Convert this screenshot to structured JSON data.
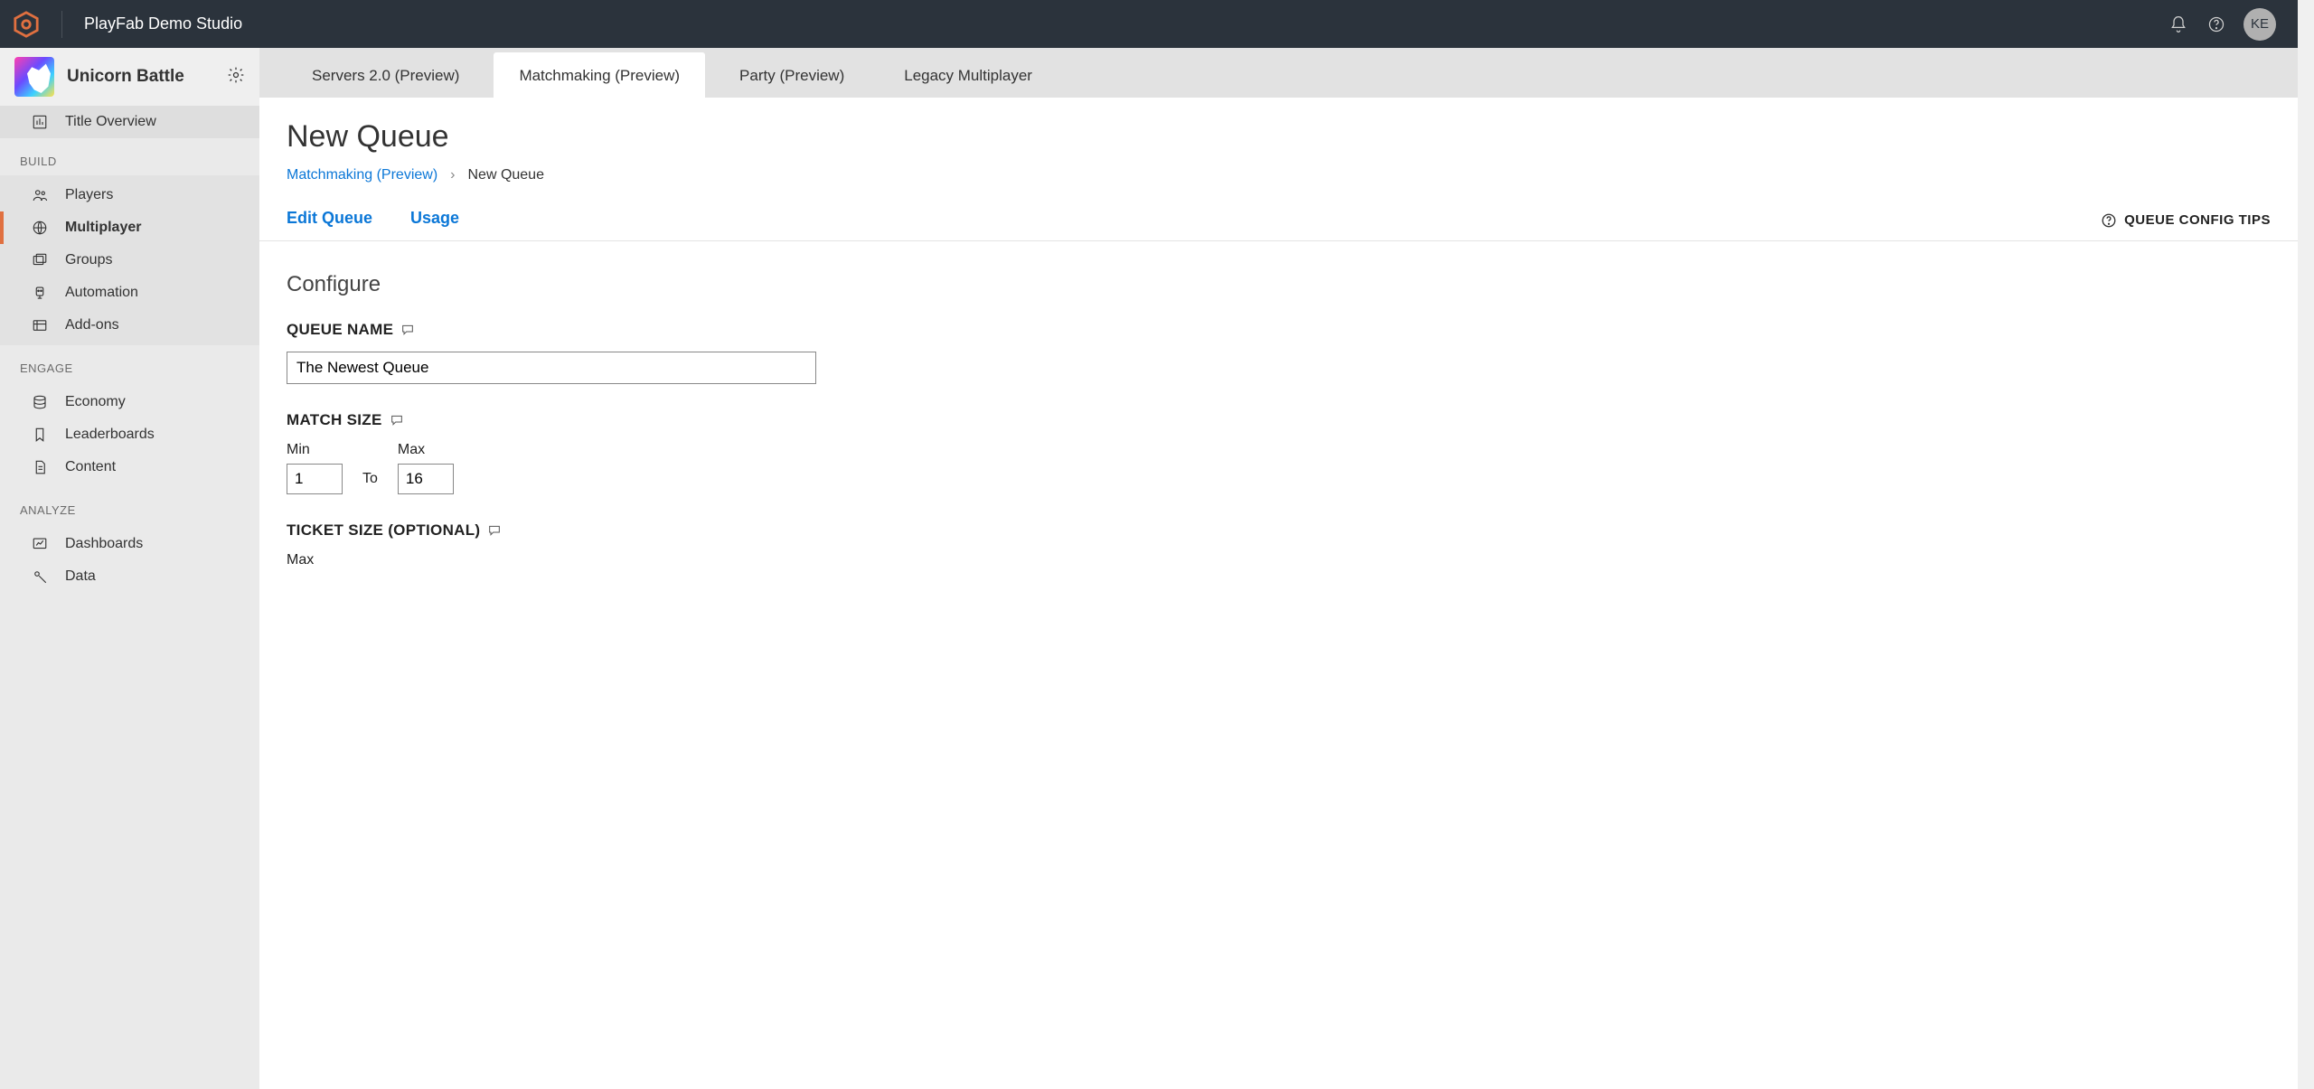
{
  "header": {
    "studio": "PlayFab Demo Studio",
    "avatar": "KE"
  },
  "title": {
    "name": "Unicorn Battle"
  },
  "sidebar": {
    "overview": "Title Overview",
    "sections": {
      "build": {
        "label": "BUILD",
        "items": [
          "Players",
          "Multiplayer",
          "Groups",
          "Automation",
          "Add-ons"
        ]
      },
      "engage": {
        "label": "ENGAGE",
        "items": [
          "Economy",
          "Leaderboards",
          "Content"
        ]
      },
      "analyze": {
        "label": "ANALYZE",
        "items": [
          "Dashboards",
          "Data"
        ]
      }
    }
  },
  "tabs": [
    "Servers 2.0 (Preview)",
    "Matchmaking (Preview)",
    "Party (Preview)",
    "Legacy Multiplayer"
  ],
  "page": {
    "title": "New Queue",
    "breadcrumb": {
      "parent": "Matchmaking (Preview)",
      "current": "New Queue"
    },
    "subtabs": [
      "Edit Queue",
      "Usage"
    ],
    "tips": "QUEUE CONFIG TIPS",
    "configure_heading": "Configure",
    "fields": {
      "queue_name": {
        "label": "QUEUE NAME",
        "value": "The Newest Queue"
      },
      "match_size": {
        "label": "MATCH SIZE",
        "min_label": "Min",
        "max_label": "Max",
        "to": "To",
        "min": "1",
        "max": "16"
      },
      "ticket_size": {
        "label": "TICKET SIZE (OPTIONAL)",
        "max_label": "Max"
      }
    }
  }
}
